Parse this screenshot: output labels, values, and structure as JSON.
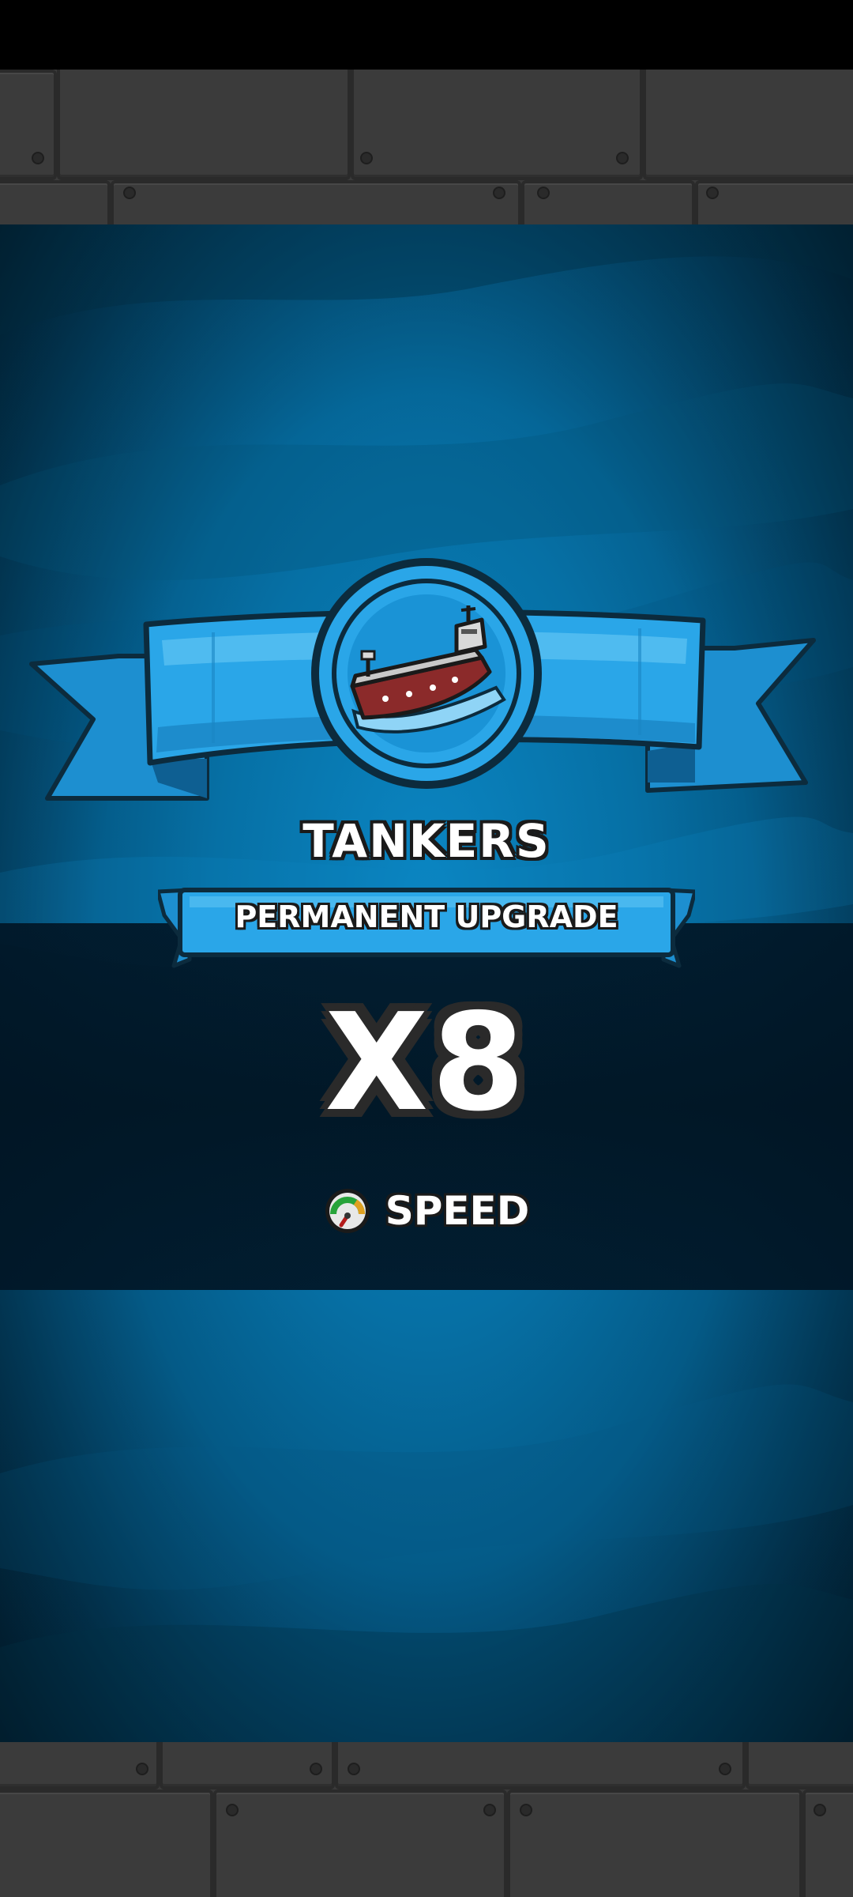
{
  "reward": {
    "title": "TANKERS",
    "subtitle": "PERMANENT UPGRADE",
    "multiplier": "X8",
    "stat_label": "SPEED",
    "icon": "tanker-ship-icon",
    "stat_icon": "speedometer-icon"
  },
  "colors": {
    "ribbon": "#2aa6e8",
    "ocean": "#0670a5",
    "outline": "#1a1a1a"
  }
}
